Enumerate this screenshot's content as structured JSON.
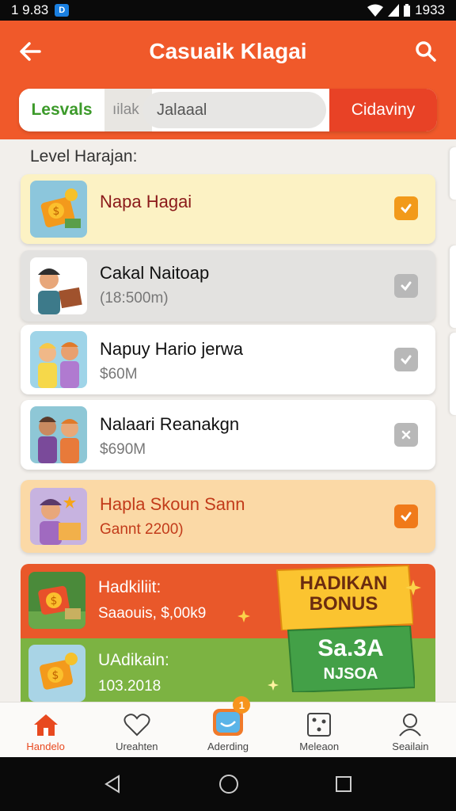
{
  "status_bar": {
    "time": "1 9.83",
    "app_badge": "D",
    "right": "1933"
  },
  "header": {
    "title": "Casuaik Klagai"
  },
  "filter_bar": {
    "levels_label": "Lesvals",
    "sort_label": "ıilak",
    "search_value": "Jalaaal",
    "category_label": "Cidaviny"
  },
  "section_label": "Level Harajan:",
  "levels": [
    {
      "title": "Napa Hagai",
      "subtitle": ""
    },
    {
      "title": "Cakal Naitoap",
      "subtitle": "(18:500m)"
    },
    {
      "title": "Napuy Hario jerwa",
      "subtitle": "$60M"
    },
    {
      "title": "Nalaari Reanakgn",
      "subtitle": "$690M"
    },
    {
      "title": "Hapla Skoun Sann",
      "subtitle": "Gannt 2200)"
    }
  ],
  "promos": [
    {
      "title": "Hadkiliit:",
      "subtitle": "Saaouis, $,00k9"
    },
    {
      "title": "UAdikain:",
      "subtitle": "103.2018"
    }
  ],
  "bonus": {
    "line1": "HADIKAN",
    "line2": "BONUS",
    "main": "Sa.3A",
    "sub": "NJSOA"
  },
  "bottom_nav": [
    {
      "label": "Handelo"
    },
    {
      "label": "Ureahten"
    },
    {
      "label": "Aderding",
      "badge": "1"
    },
    {
      "label": "Meleaon"
    },
    {
      "label": "Seailain"
    }
  ],
  "colors": {
    "brand": "#f0592a",
    "accent_green": "#3c9a2a",
    "check_orange": "#f29a1a"
  },
  "icons": [
    "back-arrow-icon",
    "search-icon",
    "home-icon",
    "heart-icon",
    "game-icon",
    "dice-icon",
    "user-icon"
  ]
}
